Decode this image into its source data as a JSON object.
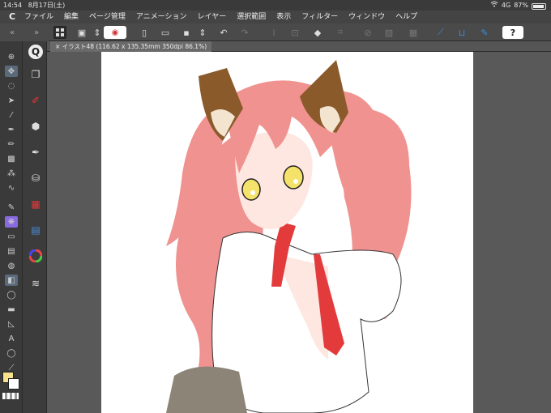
{
  "status": {
    "time": "14:54",
    "date": "8月17日(土)",
    "network": "4G",
    "battery": "87%",
    "battery_level": 0.87
  },
  "menu": {
    "logo": "C",
    "items": [
      "ファイル",
      "編集",
      "ページ管理",
      "アニメーション",
      "レイヤー",
      "選択範囲",
      "表示",
      "フィルター",
      "ウィンドウ",
      "ヘルプ"
    ]
  },
  "document": {
    "tab_title": "イラスト48 (116.62 x 135.35mm 350dpi 86.1%)"
  },
  "colors": {
    "main_color": "#f5e28a",
    "sub_color": "#ffffff",
    "accent": "#3b8ed8"
  }
}
